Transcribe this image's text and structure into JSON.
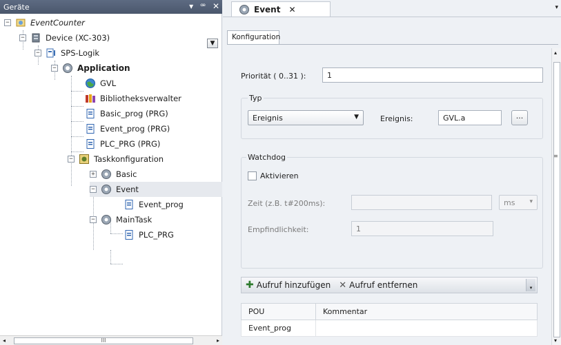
{
  "left_pane": {
    "title": "Geräte",
    "controls": [
      "▾",
      "ꟹ",
      "✕"
    ],
    "tree_dropdown_glyph": "▼",
    "scroll_glyph": "III",
    "tree": [
      {
        "label": "EventCounter",
        "style": "italic",
        "icon": "project-icon"
      },
      {
        "label": "Device (XC-303)",
        "style": "normal",
        "icon": "device-icon"
      },
      {
        "label": "SPS-Logik",
        "style": "normal",
        "icon": "plc-logic-icon"
      },
      {
        "label": "Application",
        "style": "bold",
        "icon": "application-gear-icon"
      },
      {
        "label": "GVL",
        "style": "normal",
        "icon": "globe-icon"
      },
      {
        "label": "Bibliotheksverwalter",
        "style": "normal",
        "icon": "library-icon"
      },
      {
        "label": "Basic_prog (PRG)",
        "style": "normal",
        "icon": "program-icon"
      },
      {
        "label": "Event_prog (PRG)",
        "style": "normal",
        "icon": "program-icon"
      },
      {
        "label": "PLC_PRG (PRG)",
        "style": "normal",
        "icon": "program-icon"
      },
      {
        "label": "Taskkonfiguration",
        "style": "normal",
        "icon": "task-config-icon"
      },
      {
        "label": "Basic",
        "style": "normal",
        "icon": "task-icon"
      },
      {
        "label": "Event",
        "style": "normal",
        "icon": "task-icon",
        "selected": true
      },
      {
        "label": "Event_prog",
        "style": "normal",
        "icon": "program-call-icon"
      },
      {
        "label": "MainTask",
        "style": "normal",
        "icon": "task-icon"
      },
      {
        "label": "PLC_PRG",
        "style": "normal",
        "icon": "program-call-icon"
      }
    ]
  },
  "editor": {
    "tab_label": "Event",
    "tab_close": "✕",
    "subtab_label": "Konfiguration",
    "priority_label": "Priorität ( 0..31 ):",
    "priority_value": "1",
    "typ": {
      "title": "Typ",
      "type_value": "Ereignis",
      "event_label": "Ereignis:",
      "event_value": "GVL.a",
      "browse_label": "..."
    },
    "watchdog": {
      "title": "Watchdog",
      "activate_label": "Aktivieren",
      "time_label": "Zeit (z.B. t#200ms):",
      "time_value": "",
      "time_unit": "ms",
      "sensitivity_label": "Empfindlichkeit:",
      "sensitivity_value": "1"
    },
    "callbar": {
      "add_label": "Aufruf hinzufügen",
      "remove_label": "Aufruf entfernen"
    },
    "table": {
      "headers": [
        "POU",
        "Kommentar"
      ],
      "rows": [
        [
          "Event_prog",
          ""
        ]
      ]
    }
  },
  "colors": {
    "header_bg": "#4f5c72",
    "accent_green": "#2d7a2d",
    "pane_bg": "#eef1f5"
  }
}
